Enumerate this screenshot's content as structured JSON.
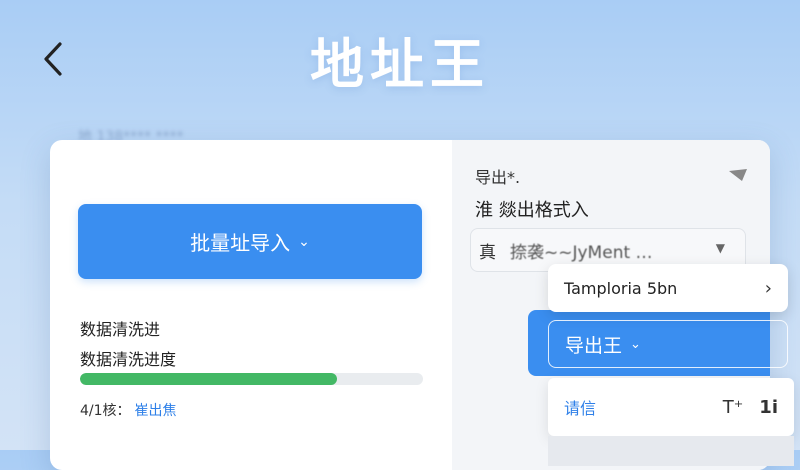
{
  "header": {
    "title": "地址王",
    "back_icon": "chevron-left-icon",
    "blurred_line": "地 138**** ****"
  },
  "left_panel": {
    "import_button_label": "批量址导入",
    "progress_title": "数据清洗进",
    "progress_subtitle": "数据清洗进度",
    "progress_value": 0.75,
    "progress_status_prefix": "4/1核：",
    "progress_status_link": "崔出焦"
  },
  "right_panel": {
    "export_label": "导出*.",
    "format_label": "淮  燚出格式入",
    "format_select_prefix": "真",
    "format_select_value": "捺袭~~JyMent  …",
    "template_item_label": "Tamploria 5bn",
    "export_button_label": "导出王",
    "request_label": "请信",
    "text_size_icon_label": "T⁺",
    "spacing_icon_label": "1i"
  },
  "colors": {
    "accent": "#3a8ef0",
    "progress": "#43b865",
    "link": "#2f80e8"
  }
}
